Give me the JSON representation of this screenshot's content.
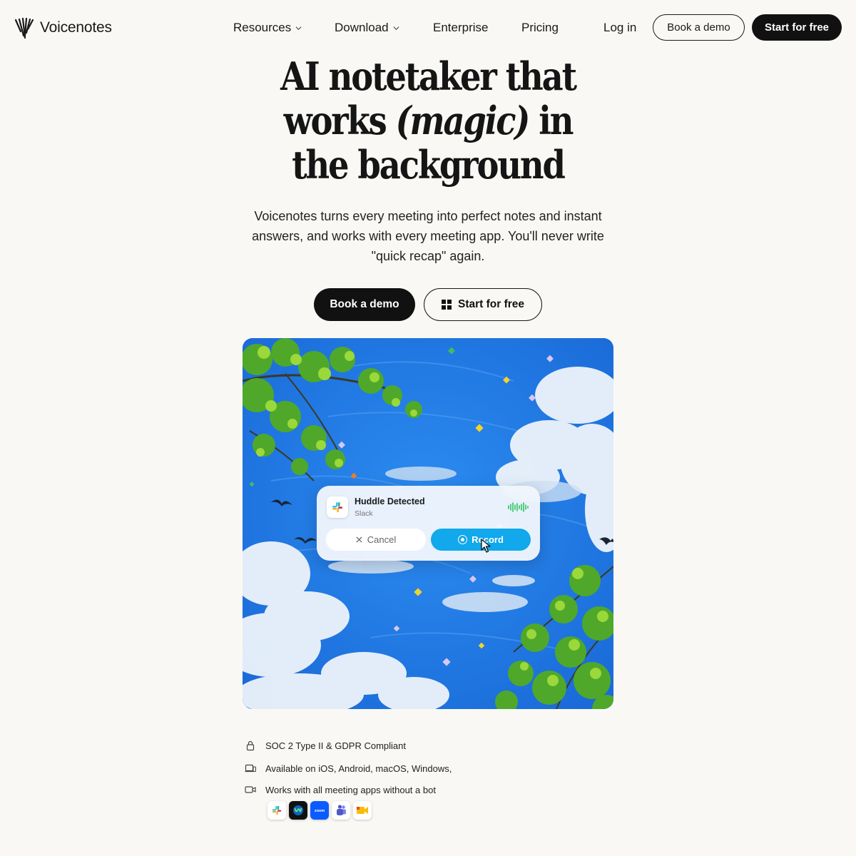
{
  "brand": {
    "name": "Voicenotes"
  },
  "nav": {
    "links": [
      {
        "label": "Resources",
        "has_dropdown": true
      },
      {
        "label": "Download",
        "has_dropdown": true
      },
      {
        "label": "Enterprise",
        "has_dropdown": false
      },
      {
        "label": "Pricing",
        "has_dropdown": false
      }
    ],
    "login": "Log in",
    "book_demo": "Book a demo",
    "start_free": "Start for free"
  },
  "hero": {
    "title_line1": "AI notetaker that",
    "title_line2_a": "works ",
    "title_line2_em": "(magic)",
    "title_line2_b": " in",
    "title_line3": "the background",
    "subtitle": "Voicenotes turns every meeting into perfect notes and instant answers, and works with every meeting app. You'll never write \"quick recap\" again.",
    "cta_primary": "Book a demo",
    "cta_secondary": "Start for free"
  },
  "widget": {
    "title": "Huddle Detected",
    "source": "Slack",
    "cancel_label": "Cancel",
    "record_label": "Record"
  },
  "features": [
    {
      "icon": "lock-icon",
      "text": "SOC 2 Type II & GDPR Compliant"
    },
    {
      "icon": "devices-icon",
      "text": "Available on iOS, Android, macOS, Windows,"
    },
    {
      "icon": "video-camera-icon",
      "text": "Works with all meeting apps without a bot"
    }
  ],
  "meeting_apps": [
    {
      "name": "slack-icon",
      "color": "#ffffff"
    },
    {
      "name": "webex-icon",
      "color": "#111111"
    },
    {
      "name": "zoom-icon",
      "color": "#0b5cff",
      "label": "zoom"
    },
    {
      "name": "teams-icon",
      "color": "#ffffff"
    },
    {
      "name": "google-meet-icon",
      "color": "#ffffff"
    }
  ],
  "colors": {
    "background": "#f9f8f4",
    "primary_dark": "#111111",
    "record_blue": "#11a8ec",
    "sky_blue": "#2479e2"
  }
}
